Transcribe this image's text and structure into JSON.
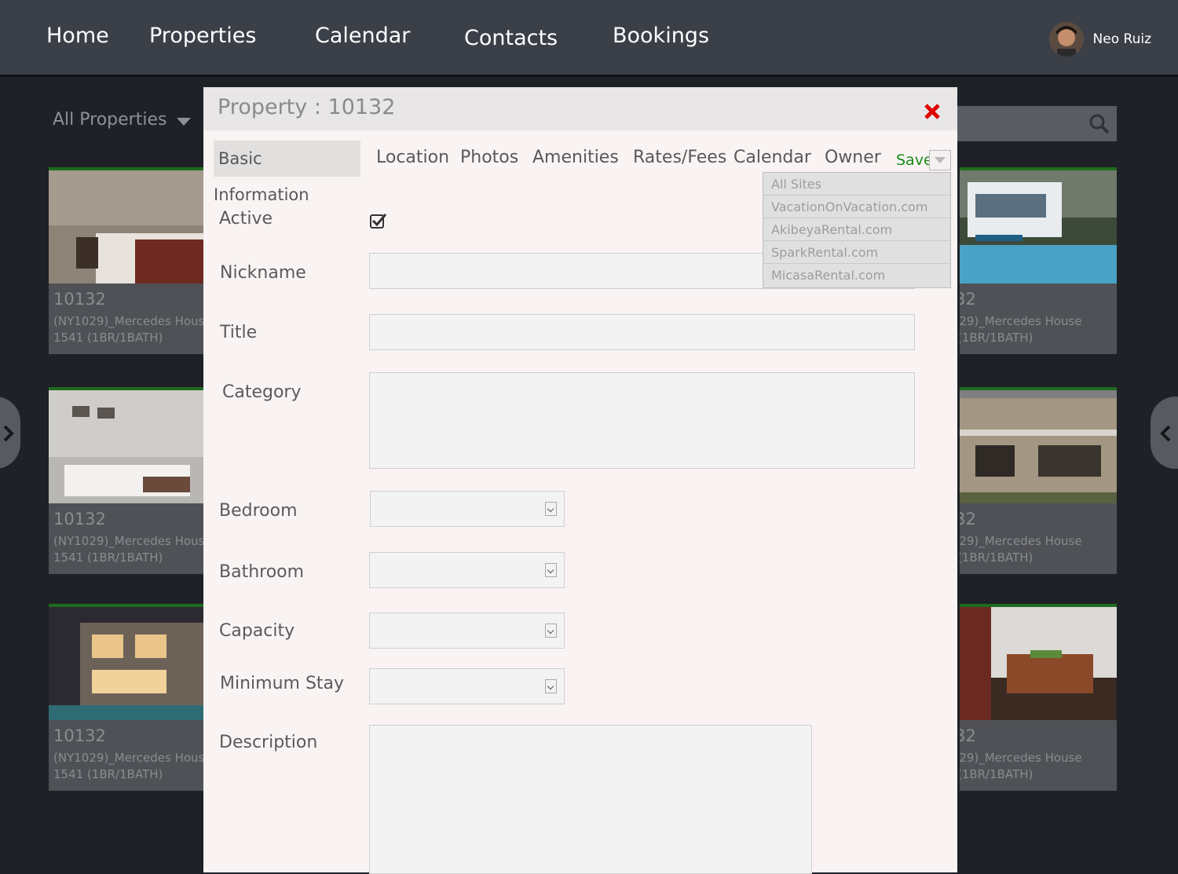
{
  "nav": {
    "items": [
      "Home",
      "Properties",
      "Calendar",
      "Contacts",
      "Bookings"
    ],
    "user_name": "Neo Ruiz"
  },
  "background": {
    "filter_label": "All Properties",
    "cards": [
      {
        "id": "10132",
        "name": "(NY1029)_Mercedes House\n1541 (1BR/1BATH)"
      },
      {
        "id": "10132",
        "name": "(NY1029)_Mercedes House\n1541 (1BR/1BATH)"
      },
      {
        "id": "10132",
        "name": "(NY1029)_Mercedes House\n1541 (1BR/1BATH)"
      },
      {
        "id": "10132",
        "name": "(NY1029)_Mercedes House\n1541 (1BR/1BATH)"
      },
      {
        "id": "10132",
        "name": "(NY1029)_Mercedes House\n1541 (1BR/1BATH)"
      },
      {
        "id": "10132",
        "name": "(NY1029)_Mercedes House\n1541 (1BR/1BATH)"
      }
    ]
  },
  "modal": {
    "title": "Property : 10132",
    "tabs": [
      "Basic Information",
      "Location",
      "Photos",
      "Amenities",
      "Rates/Fees",
      "Calendar",
      "Owner"
    ],
    "active_tab": "Basic Information",
    "save_label": "Save",
    "save_options": [
      "All Sites",
      "VacationOnVacation.com",
      "AkibeyaRental.com",
      "SparkRental.com",
      "MicasaRental.com"
    ],
    "fields": {
      "active_label": "Active",
      "active_checked": true,
      "nickname_label": "Nickname",
      "nickname_value": "",
      "title_label": "Title",
      "title_value": "",
      "category_label": "Category",
      "category_value": "",
      "bedroom_label": "Bedroom",
      "bathroom_label": "Bathroom",
      "capacity_label": "Capacity",
      "minimum_stay_label": "Minimum Stay",
      "description_label": "Description",
      "description_value": ""
    }
  },
  "colors": {
    "nav_bg": "#3a3f48",
    "page_bg": "#1e2126",
    "modal_bg": "#f9f4f3",
    "save_green": "#1c8a1c",
    "close_red": "#e00000",
    "card_accent": "#1f6b1f"
  }
}
